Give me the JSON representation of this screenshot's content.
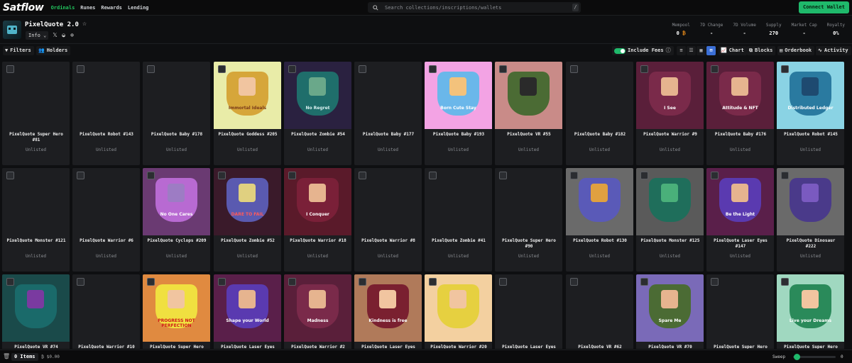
{
  "nav": {
    "logo": "Satflow",
    "links": [
      "Ordinals",
      "Runes",
      "Rewards",
      "Lending"
    ],
    "active": "Ordinals",
    "search_placeholder": "Search collections/inscriptions/wallets",
    "search_shortcut": "/",
    "connect_label": "Connect Wallet"
  },
  "collection": {
    "name": "PixelQuote 2.0",
    "info_label": "Info",
    "stats": [
      {
        "label": "Mempool",
        "value": "0",
        "unit": "₿"
      },
      {
        "label": "7D Change",
        "value": "-"
      },
      {
        "label": "7D Volume",
        "value": "-"
      },
      {
        "label": "Supply",
        "value": "270"
      },
      {
        "label": "Market Cap",
        "value": "-"
      },
      {
        "label": "Royalty",
        "value": "0%"
      }
    ]
  },
  "toolbar": {
    "filters_label": "Filters",
    "holders_label": "Holders",
    "include_fees_label": "Include Fees",
    "chart_label": "Chart",
    "blocks_label": "Blocks",
    "orderbook_label": "Orderbook",
    "activity_label": "Activity"
  },
  "cards": [
    {
      "name": "PixelQuote Super Hero #81",
      "status": "Unlisted",
      "art": "none"
    },
    {
      "name": "PixelQuote Robot #143",
      "status": "Unlisted",
      "art": "none"
    },
    {
      "name": "PixelQuote Baby #178",
      "status": "Unlisted",
      "art": "none"
    },
    {
      "name": "PixelQuote Goddess #205",
      "status": "Unlisted",
      "art": "goddess",
      "caption": "Immortal Ideals"
    },
    {
      "name": "PixelQuote Zombie #54",
      "status": "Unlisted",
      "art": "zombie",
      "caption": "No Regret"
    },
    {
      "name": "PixelQuote Baby #177",
      "status": "Unlisted",
      "art": "none"
    },
    {
      "name": "PixelQuote Baby #193",
      "status": "Unlisted",
      "art": "baby",
      "caption": "Born Cute Stay"
    },
    {
      "name": "PixelQuote VR #55",
      "status": "Unlisted",
      "art": "vr",
      "caption": ""
    },
    {
      "name": "PixelQuote Baby #182",
      "status": "Unlisted",
      "art": "none"
    },
    {
      "name": "PixelQuote Warrior #9",
      "status": "Unlisted",
      "art": "warrior",
      "caption": "I See"
    },
    {
      "name": "PixelQuote Baby #176",
      "status": "Unlisted",
      "art": "baby2",
      "caption": "Attitude & NFT"
    },
    {
      "name": "PixelQuote Robot #145",
      "status": "Unlisted",
      "art": "robot",
      "caption": "Distributed Ledger"
    },
    {
      "name": "PixelQuote Monster #121",
      "status": "Unlisted",
      "art": "none"
    },
    {
      "name": "PixelQuote Warrior #6",
      "status": "Unlisted",
      "art": "none"
    },
    {
      "name": "PixelQuote Cyclops #209",
      "status": "Unlisted",
      "art": "cyclops",
      "caption": "No One Cares"
    },
    {
      "name": "PixelQuote Zombie #52",
      "status": "Unlisted",
      "art": "zombie2",
      "caption": "DARE TO FAIL"
    },
    {
      "name": "PixelQuote Warrior #18",
      "status": "Unlisted",
      "art": "viking",
      "caption": "I Conquer"
    },
    {
      "name": "PixelQuote Warrior #8",
      "status": "Unlisted",
      "art": "none"
    },
    {
      "name": "PixelQuote Zombie #41",
      "status": "Unlisted",
      "art": "none"
    },
    {
      "name": "PixelQuote Super Hero #90",
      "status": "Unlisted",
      "art": "none"
    },
    {
      "name": "PixelQuote Robot #130",
      "status": "Unlisted",
      "art": "robot2",
      "caption": ""
    },
    {
      "name": "PixelQuote Monster #125",
      "status": "Unlisted",
      "art": "monster",
      "caption": ""
    },
    {
      "name": "PixelQuote Laser Eyes #147",
      "status": "Unlisted",
      "art": "laser",
      "caption": "Be the Light"
    },
    {
      "name": "PixelQuote Dinosaur #222",
      "status": "Unlisted",
      "art": "dino",
      "caption": ""
    },
    {
      "name": "PixelQuote VR #74",
      "status": "",
      "art": "vr2",
      "caption": ""
    },
    {
      "name": "PixelQuote Warrior #10",
      "status": "",
      "art": "none"
    },
    {
      "name": "PixelQuote Super Hero",
      "status": "",
      "art": "super",
      "caption": "PROGRESS NOT PERFECTION"
    },
    {
      "name": "PixelQuote Laser Eyes",
      "status": "",
      "art": "laser2",
      "caption": "Shape your World"
    },
    {
      "name": "PixelQuote Warrior #2",
      "status": "",
      "art": "warrior2",
      "caption": "Madness"
    },
    {
      "name": "PixelQuote Laser Eyes",
      "status": "",
      "art": "kind",
      "caption": "Kindness is free"
    },
    {
      "name": "PixelQuote Warrior #20",
      "status": "",
      "art": "tri",
      "caption": ""
    },
    {
      "name": "PixelQuote Laser Eyes",
      "status": "",
      "art": "none"
    },
    {
      "name": "PixelQuote VR #62",
      "status": "",
      "art": "none"
    },
    {
      "name": "PixelQuote VR #70",
      "status": "",
      "art": "vr3",
      "caption": "Spare Me"
    },
    {
      "name": "PixelQuote Super Hero",
      "status": "",
      "art": "none"
    },
    {
      "name": "PixelQuote Super Hero",
      "status": "",
      "art": "hero",
      "caption": "Live your Dreams"
    }
  ],
  "bottom": {
    "items_label": "0 Items",
    "balance": "₿ $0.00",
    "sweep_label": "Sweep",
    "sweep_value": "0"
  }
}
